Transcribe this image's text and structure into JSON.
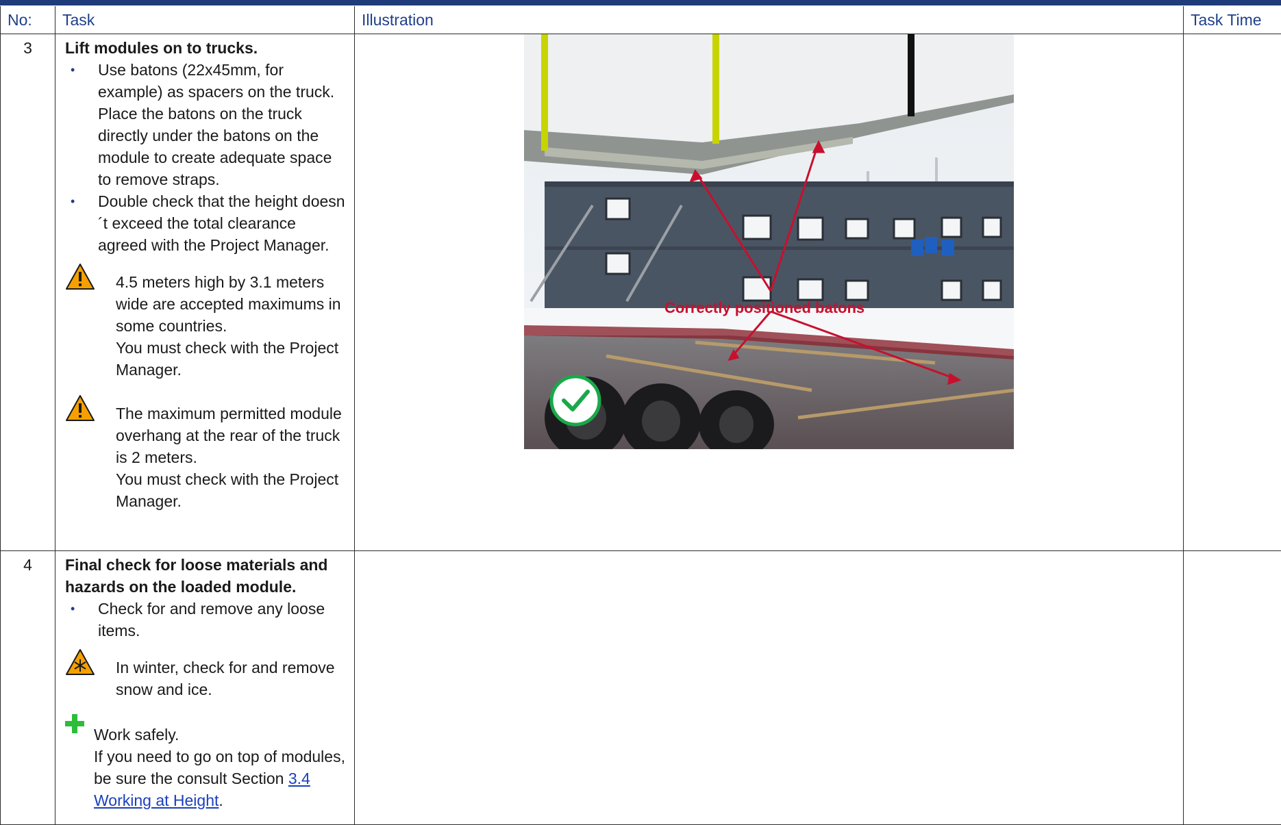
{
  "columns": {
    "no": "No:",
    "task": "Task",
    "illustration": "Illustration",
    "time": "Task Time"
  },
  "rows": [
    {
      "no": "3",
      "heading": "Lift modules on to trucks.",
      "bullets": [
        "Use batons (22x45mm, for example) as spacers on the truck. Place the batons on the truck directly under the batons on the module to create adequate space to remove straps.",
        "Double check that the height doesn´t exceed the total clearance agreed with the Project Manager."
      ],
      "warnings": [
        {
          "text": "4.5 meters high by 3.1 meters wide are accepted maximums in some countries.",
          "check": "You must check with the Project Manager.",
          "icon": "warning-icon"
        },
        {
          "text": "The maximum permitted module overhang at the rear of the truck is 2 meters.",
          "check": "You must check with the Project Manager.",
          "icon": "warning-icon"
        }
      ],
      "illustration": {
        "annotation": "Correctly positioned batons",
        "check_icon": "check-circle-icon"
      }
    },
    {
      "no": "4",
      "heading": "Final check for loose materials and hazards on the loaded module.",
      "bullets": [
        "Check for and remove any loose items."
      ],
      "winter": {
        "text": "In winter, check for and remove snow and ice.",
        "icon": "snowflake-warning-icon"
      },
      "safety": {
        "title": "Work safely.",
        "text": "If you need to go on top of modules, be sure the consult Section ",
        "link": "3.4 Working at Height",
        "end": ".",
        "icon": "plus-icon"
      }
    }
  ],
  "colors": {
    "header_text": "#1f3f8a",
    "top_bar": "#1f3b7a",
    "warning": "#f5a000",
    "annotation": "#c8102e",
    "plus": "#2ebd3a",
    "check": "#1aa84a"
  }
}
